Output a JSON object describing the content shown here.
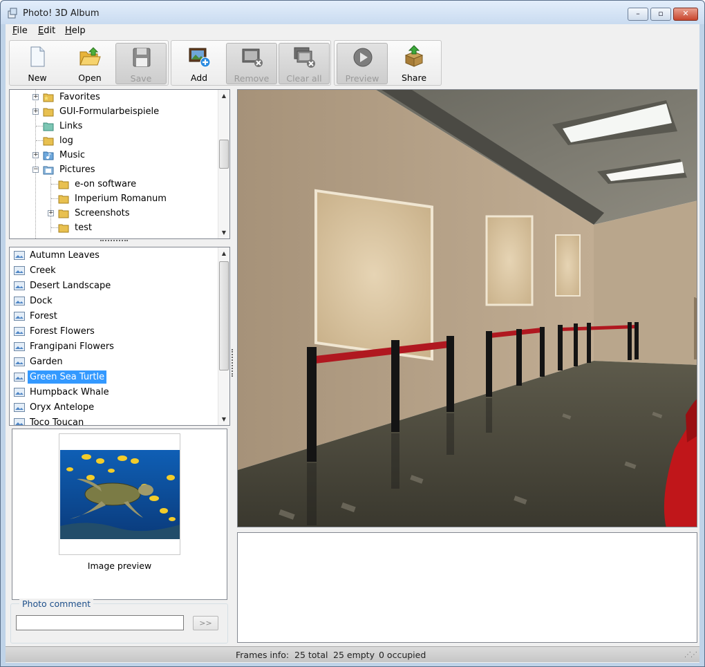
{
  "window": {
    "title": "Photo! 3D Album"
  },
  "title_buttons": {
    "minimize": "–",
    "maximize": "▫",
    "close": "✕"
  },
  "menu": [
    {
      "label": "File",
      "accel": "F",
      "rest": "ile"
    },
    {
      "label": "Edit",
      "accel": "E",
      "rest": "dit"
    },
    {
      "label": "Help",
      "accel": "H",
      "rest": "elp"
    }
  ],
  "toolbar": {
    "new": "New",
    "open": "Open",
    "save": "Save",
    "add": "Add",
    "remove": "Remove",
    "clear_all": "Clear all",
    "preview": "Preview",
    "share": "Share"
  },
  "folder_tree": [
    {
      "label": "Favorites",
      "expander": "+",
      "level": 1
    },
    {
      "label": "GUI-Formularbeispiele",
      "expander": "+",
      "level": 1
    },
    {
      "label": "Links",
      "expander": "",
      "level": 1
    },
    {
      "label": "log",
      "expander": "",
      "level": 1
    },
    {
      "label": "Music",
      "expander": "+",
      "level": 1
    },
    {
      "label": "Pictures",
      "expander": "−",
      "level": 1
    },
    {
      "label": "e-on software",
      "expander": "",
      "level": 2
    },
    {
      "label": "Imperium Romanum",
      "expander": "",
      "level": 2
    },
    {
      "label": "Screenshots",
      "expander": "+",
      "level": 2
    },
    {
      "label": "test",
      "expander": "",
      "level": 2
    }
  ],
  "photo_list": {
    "items": [
      "Autumn Leaves",
      "Creek",
      "Desert Landscape",
      "Dock",
      "Forest",
      "Forest Flowers",
      "Frangipani Flowers",
      "Garden",
      "Green Sea Turtle",
      "Humpback Whale",
      "Oryx Antelope",
      "Toco Toucan"
    ],
    "selected_index": 8
  },
  "preview": {
    "caption": "Image preview"
  },
  "comment": {
    "legend": "Photo comment",
    "value": "",
    "apply_button": ">>"
  },
  "status": {
    "label": "Frames info:",
    "total": "25 total",
    "empty": "25 empty",
    "occupied": "0 occupied"
  },
  "colors": {
    "selection": "#3399ff",
    "rope": "#b01820",
    "wall": "#b4a28a"
  }
}
